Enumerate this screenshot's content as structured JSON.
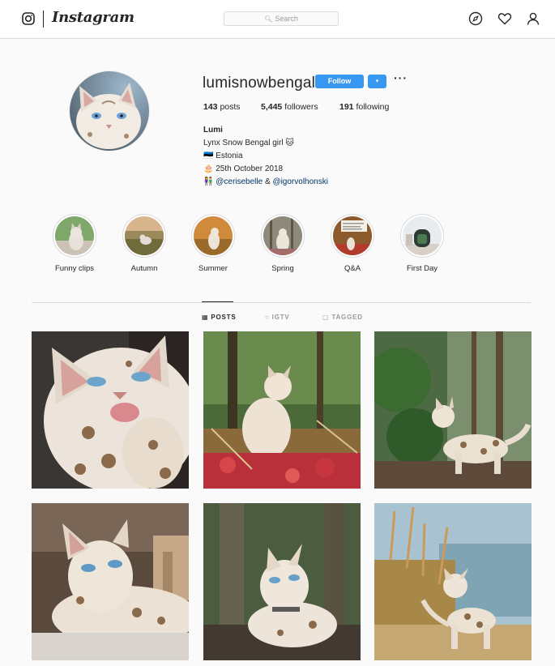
{
  "header": {
    "brand": "Instagram",
    "search_placeholder": "Search",
    "icons": [
      "instagram-logo-icon",
      "compass-icon",
      "heart-icon",
      "profile-icon"
    ]
  },
  "profile": {
    "username": "lumisnowbengal",
    "follow_label": "Follow",
    "dropdown_glyph": "▾",
    "more_glyph": "···",
    "stats": {
      "posts_count": "143",
      "posts_label": "posts",
      "followers_count": "5,445",
      "followers_label": "followers",
      "following_count": "191",
      "following_label": "following"
    },
    "bio": {
      "name": "Lumi",
      "line1": "Lynx Snow Bengal girl 🐱",
      "line2": "🇪🇪 Estonia",
      "line3": "🎂 25th October 2018",
      "line4_icon": "👫",
      "mention1": "@cerisebelle",
      "amp": " & ",
      "mention2": "@igorvolhonski"
    }
  },
  "highlights": [
    {
      "label": "Funny clips"
    },
    {
      "label": "Autumn"
    },
    {
      "label": "Summer"
    },
    {
      "label": "Spring"
    },
    {
      "label": "Q&A"
    },
    {
      "label": "First Day"
    }
  ],
  "tabs": [
    {
      "label": "POSTS",
      "active": true
    },
    {
      "label": "IGTV",
      "active": false
    },
    {
      "label": "TAGGED",
      "active": false
    }
  ],
  "colors": {
    "accent": "#3897f0",
    "border": "#dbdbdb",
    "link": "#003569",
    "background": "#fafafa"
  }
}
